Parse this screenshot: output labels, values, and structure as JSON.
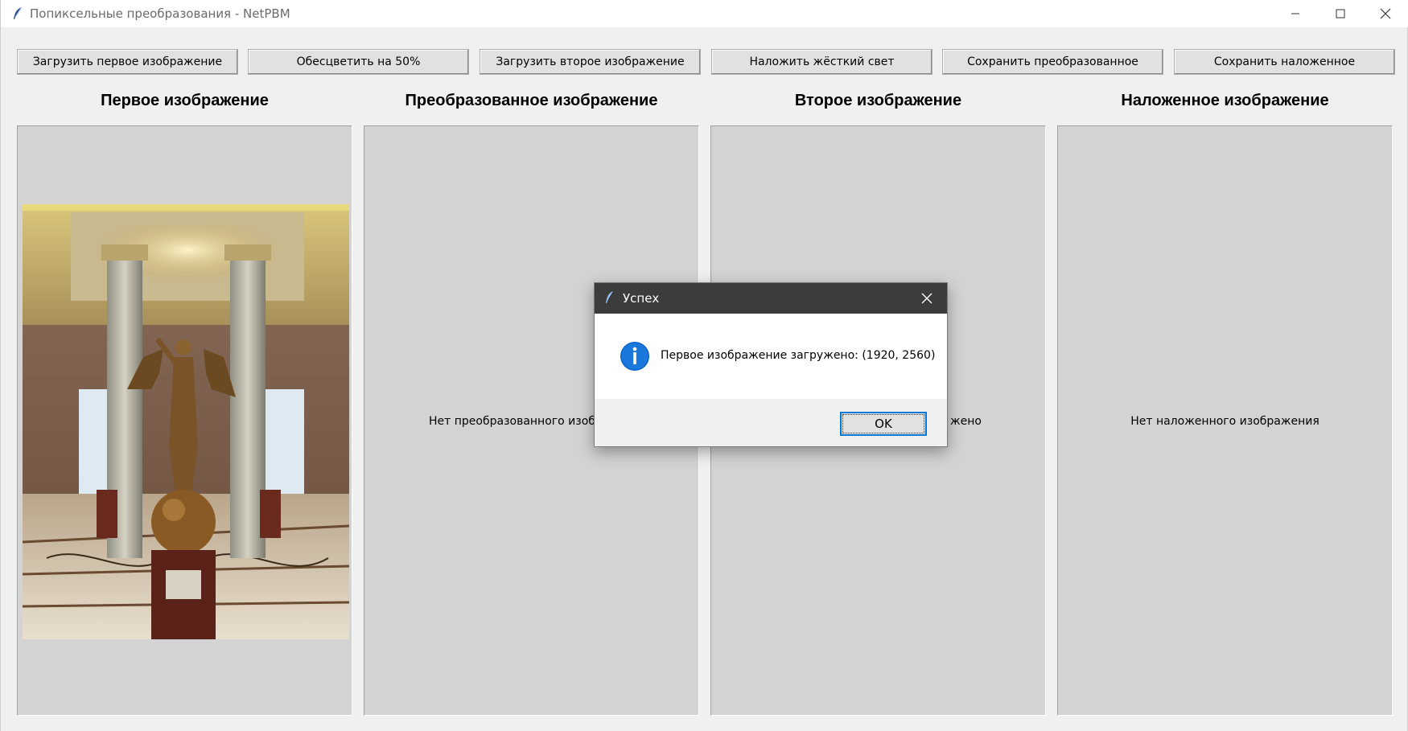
{
  "window": {
    "title": "Попиксельные преобразования - NetPBM",
    "icon": "feather-icon"
  },
  "toolbar": {
    "buttons": [
      {
        "label": "Загрузить первое изображение"
      },
      {
        "label": "Обесцветить на 50%"
      },
      {
        "label": "Загрузить второе изображение"
      },
      {
        "label": "Наложить жёсткий свет"
      },
      {
        "label": "Сохранить преобразованное"
      },
      {
        "label": "Сохранить наложенное"
      }
    ]
  },
  "panels": [
    {
      "title": "Первое изображение",
      "placeholder": ""
    },
    {
      "title": "Преобразованное изображение",
      "placeholder": "Нет преобразованного изобр"
    },
    {
      "title": "Второе изображение",
      "placeholder": "жено"
    },
    {
      "title": "Наложенное изображение",
      "placeholder": "Нет наложенного изображения"
    }
  ],
  "dialog": {
    "title": "Успех",
    "message": "Первое изображение загружено: (1920, 2560)",
    "ok_label": "OK",
    "icon": "info-icon"
  },
  "colors": {
    "accent": "#0078d7",
    "dialog_titlebar": "#3c3c3c",
    "panel_bg": "#d3d3d3",
    "window_bg": "#f0f0f0"
  }
}
